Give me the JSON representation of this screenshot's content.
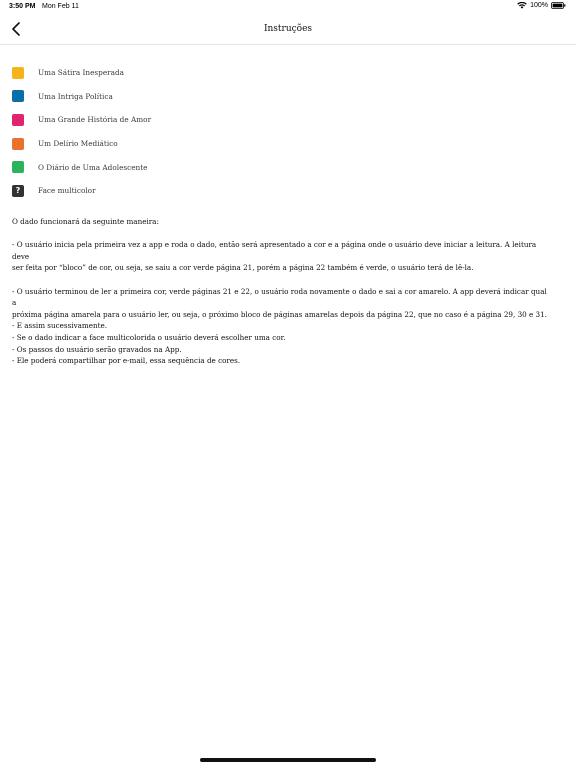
{
  "status": {
    "time": "3:50 PM",
    "date": "Mon Feb 11",
    "battery": "100%",
    "wifi_icon": "wifi-icon",
    "battery_icon": "battery-icon"
  },
  "nav": {
    "title": "Instruções",
    "back_icon": "chevron-left-icon"
  },
  "legend": [
    {
      "label": "Uma Sátira Inesperada",
      "color": "#F4B41A"
    },
    {
      "label": "Uma Intriga Política",
      "color": "#0A6FA8"
    },
    {
      "label": "Uma Grande História de Amor",
      "color": "#E0246E"
    },
    {
      "label": "Um Delírio Mediático",
      "color": "#E8712C"
    },
    {
      "label": "O Diário de Uma Adolescente",
      "color": "#2DB35E"
    },
    {
      "label": "Face multicolor",
      "color": "#333333",
      "symbol": "?"
    }
  ],
  "instructions": {
    "intro": "O dado funcionará da seguinte maneira:",
    "para1_line1": "- O usuário inicia pela primeira vez a app e roda o dado, então será apresentado a cor e a página onde o usuário deve iniciar a leitura. A leitura deve",
    "para1_line2": "ser feita por “bloco” de cor, ou seja, se saiu a cor verde página 21, porém a página 22 também é verde, o usuário terá de lê-la.",
    "para2_line1": "- O usuário terminou de ler a primeira cor, verde páginas 21 e 22, o usuário roda novamente o dado e sai a cor amarelo. A app deverá indicar qual a",
    "para2_line2": "próxima página amarela para o usuário ler, ou seja, o próximo bloco de páginas amarelas depois da página 22, que no caso é a página 29, 30 e 31.",
    "line_e_assim": "- E assim sucessivamente.",
    "line_multicolor": "- Se o dado indicar a face multicolorida o usuário deverá escolher uma cor.",
    "line_gravados": "- Os passos do usuário serão gravados na App.",
    "line_compartilhar": "- Ele poderá compartilhar por e-mail, essa sequência de cores."
  }
}
